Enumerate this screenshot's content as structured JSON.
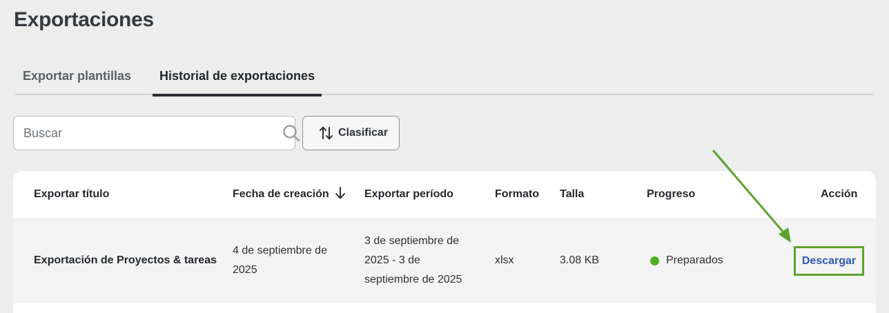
{
  "page": {
    "title": "Exportaciones"
  },
  "tabs": [
    {
      "label": "Exportar plantillas",
      "active": false
    },
    {
      "label": "Historial de exportaciones",
      "active": true
    }
  ],
  "search": {
    "placeholder": "Buscar",
    "value": ""
  },
  "sort": {
    "label": "Clasificar"
  },
  "table": {
    "columns": {
      "title": "Exportar título",
      "created": "Fecha de creación",
      "period": "Exportar período",
      "format": "Formato",
      "size": "Talla",
      "progress": "Progreso",
      "action": "Acción"
    },
    "rows": [
      {
        "title": "Exportación de Proyectos & tareas",
        "created_line1": "4 de septiembre de",
        "created_line2": "2025",
        "period_line1": "3 de septiembre de",
        "period_line2": "2025 - 3 de",
        "period_line3": "septiembre de 2025",
        "format": "xlsx",
        "size": "3.08 KB",
        "progress": "Preparados",
        "action": "Descargar"
      }
    ]
  },
  "colors": {
    "background": "#ecedec",
    "status_ready": "#4caf22",
    "link": "#2b57b8",
    "highlight": "#5aa32c"
  }
}
